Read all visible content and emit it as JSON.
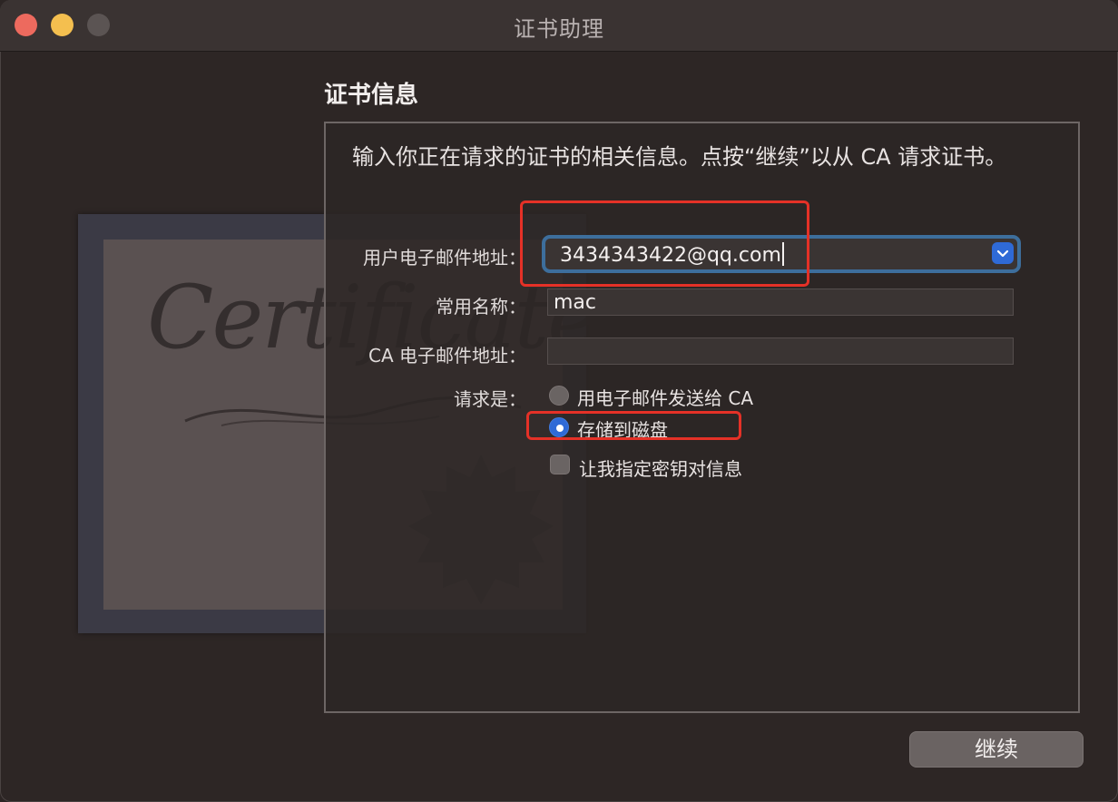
{
  "window": {
    "title": "证书助理"
  },
  "section": {
    "title": "证书信息"
  },
  "intro": "输入你正在请求的证书的相关信息。点按“继续”以从 CA 请求证书。",
  "background_art": {
    "script_text": "Certificate"
  },
  "form": {
    "email_label": "用户电子邮件地址：",
    "email_value": "3434343422@qq.com",
    "common_name_label": "常用名称：",
    "common_name_value": "mac",
    "ca_email_label": "CA 电子邮件地址：",
    "ca_email_value": "",
    "request_label": "请求是：",
    "options": [
      {
        "label": "用电子邮件发送给 CA",
        "selected": false
      },
      {
        "label": "存储到磁盘",
        "selected": true
      }
    ],
    "checkbox_label": "让我指定密钥对信息",
    "checkbox_checked": false
  },
  "buttons": {
    "continue": "继续"
  },
  "colors": {
    "accent": "#2f6ad6",
    "highlight": "#e53127",
    "focus_ring": "#3d6e9c"
  },
  "icons": [
    "close-icon",
    "minimize-icon",
    "zoom-icon",
    "chevron-down-icon",
    "radio-icon",
    "checkbox-icon",
    "seal-icon"
  ]
}
